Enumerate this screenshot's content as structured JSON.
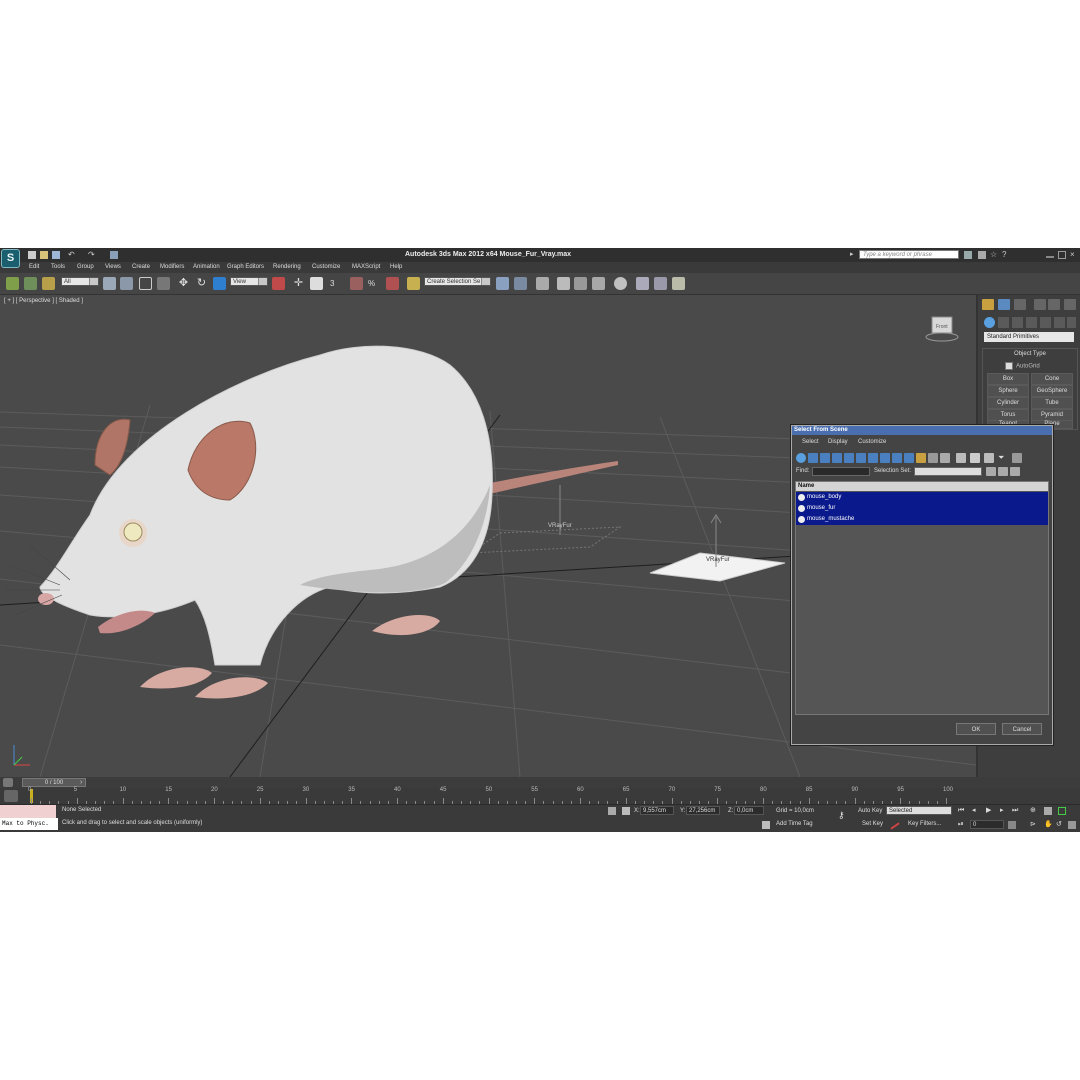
{
  "app": {
    "title": "Autodesk 3ds Max  2012 x64      Mouse_Fur_Vray.max",
    "logo_glyph": "S",
    "search_placeholder": "Type a keyword or phrase"
  },
  "menu": [
    "Edit",
    "Tools",
    "Group",
    "Views",
    "Create",
    "Modifiers",
    "Animation",
    "Graph Editors",
    "Rendering",
    "Customize",
    "MAXScript",
    "Help"
  ],
  "toolbar": {
    "selection_filter": "All",
    "ref_coord": "View",
    "named_selection": "Create Selection Se",
    "snap_3": "3",
    "snap_angle": "%"
  },
  "viewport": {
    "label": "[ + ] [ Perspective ] [ Shaded ]",
    "objects": [
      "VRayFur",
      "VRayFur"
    ],
    "viewcube_face": "Front"
  },
  "command_panel": {
    "dropdown": "Standard Primitives",
    "rollout_title": "Object Type",
    "autogrid": "AutoGrid",
    "buttons": [
      "Box",
      "Cone",
      "Sphere",
      "GeoSphere",
      "Cylinder",
      "Tube",
      "Torus",
      "Pyramid",
      "Teapot",
      "Plane"
    ]
  },
  "dialog": {
    "title": "Select From Scene",
    "menu": [
      "Select",
      "Display",
      "Customize"
    ],
    "find_label": "Find:",
    "selection_set_label": "Selection Set:",
    "column": "Name",
    "items": [
      "mouse_body",
      "mouse_fur",
      "mouse_mustache"
    ],
    "ok": "OK",
    "cancel": "Cancel"
  },
  "timeline": {
    "slider": "0 / 100",
    "ticks": [
      "0",
      "5",
      "10",
      "15",
      "20",
      "25",
      "30",
      "35",
      "40",
      "45",
      "50",
      "55",
      "60",
      "65",
      "70",
      "75",
      "80",
      "85",
      "90",
      "95",
      "100"
    ]
  },
  "status": {
    "maxscript": "Max to Physc.",
    "selection": "None Selected",
    "prompt": "Click and drag to select and scale objects (uniformly)",
    "x_label": "X:",
    "x_value": "9,557cm",
    "y_label": "Y:",
    "y_value": "27,256cm",
    "z_label": "Z:",
    "z_value": "0,0cm",
    "grid": "Grid = 10,0cm",
    "add_time_tag": "Add Time Tag",
    "auto_key": "Auto Key",
    "set_key": "Set Key",
    "key_mode": "Selected",
    "key_filters": "Key Filters...",
    "frame": "0"
  }
}
